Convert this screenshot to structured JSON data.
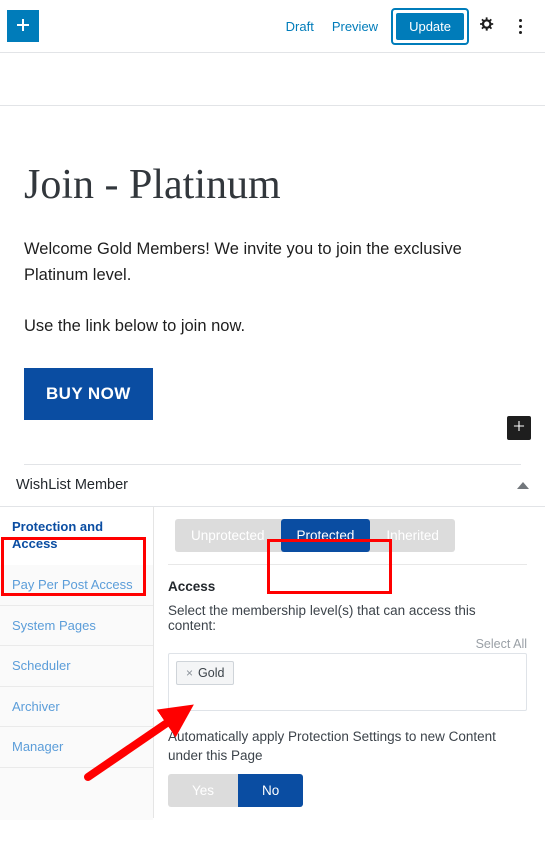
{
  "toolbar": {
    "add_block_icon": "plus-icon",
    "draft_label": "Draft",
    "preview_label": "Preview",
    "update_label": "Update",
    "settings_icon": "gear-icon",
    "more_icon": "vertical-ellipsis-icon"
  },
  "post": {
    "title": "Join - Platinum",
    "paragraph_1": "Welcome Gold Members! We invite you to join the exclusive Platinum level.",
    "paragraph_2": "Use the link below to join now.",
    "cta_label": "BUY NOW",
    "block_adder_icon": "plus-icon"
  },
  "metabox": {
    "title": "WishList Member",
    "collapse_icon": "chevron-up-icon"
  },
  "sidebar": {
    "items": [
      {
        "label": "Protection and Access",
        "active": true
      },
      {
        "label": "Pay Per Post Access",
        "active": false
      },
      {
        "label": "System Pages",
        "active": false
      },
      {
        "label": "Scheduler",
        "active": false
      },
      {
        "label": "Archiver",
        "active": false
      },
      {
        "label": "Manager",
        "active": false
      }
    ]
  },
  "protection": {
    "tabs": [
      {
        "label": "Unprotected",
        "selected": false
      },
      {
        "label": "Protected",
        "selected": true
      },
      {
        "label": "Inherited",
        "selected": false
      }
    ],
    "access_heading": "Access",
    "access_instruction": "Select the membership level(s) that can access this content:",
    "select_all_label": "Select All",
    "selected_levels": [
      {
        "remove_icon": "×",
        "label": "Gold"
      }
    ],
    "auto_apply_label": "Automatically apply Protection Settings to new Content under this Page",
    "auto_apply_options": [
      {
        "label": "Yes",
        "selected": false
      },
      {
        "label": "No",
        "selected": true
      }
    ]
  },
  "annotations": {
    "highlight_color": "#ff0000",
    "boxes": [
      {
        "name": "sidebar-protection-and-access"
      },
      {
        "name": "protected-tab"
      }
    ],
    "arrow": {
      "name": "pointer-to-gold-level",
      "color": "#ff0000"
    }
  },
  "colors": {
    "wp_blue": "#007cba",
    "brand_blue": "#0a4da2",
    "link_blue": "#5b9dd9",
    "annotation_red": "#ff0000",
    "segment_gray": "#dcdcdc"
  }
}
